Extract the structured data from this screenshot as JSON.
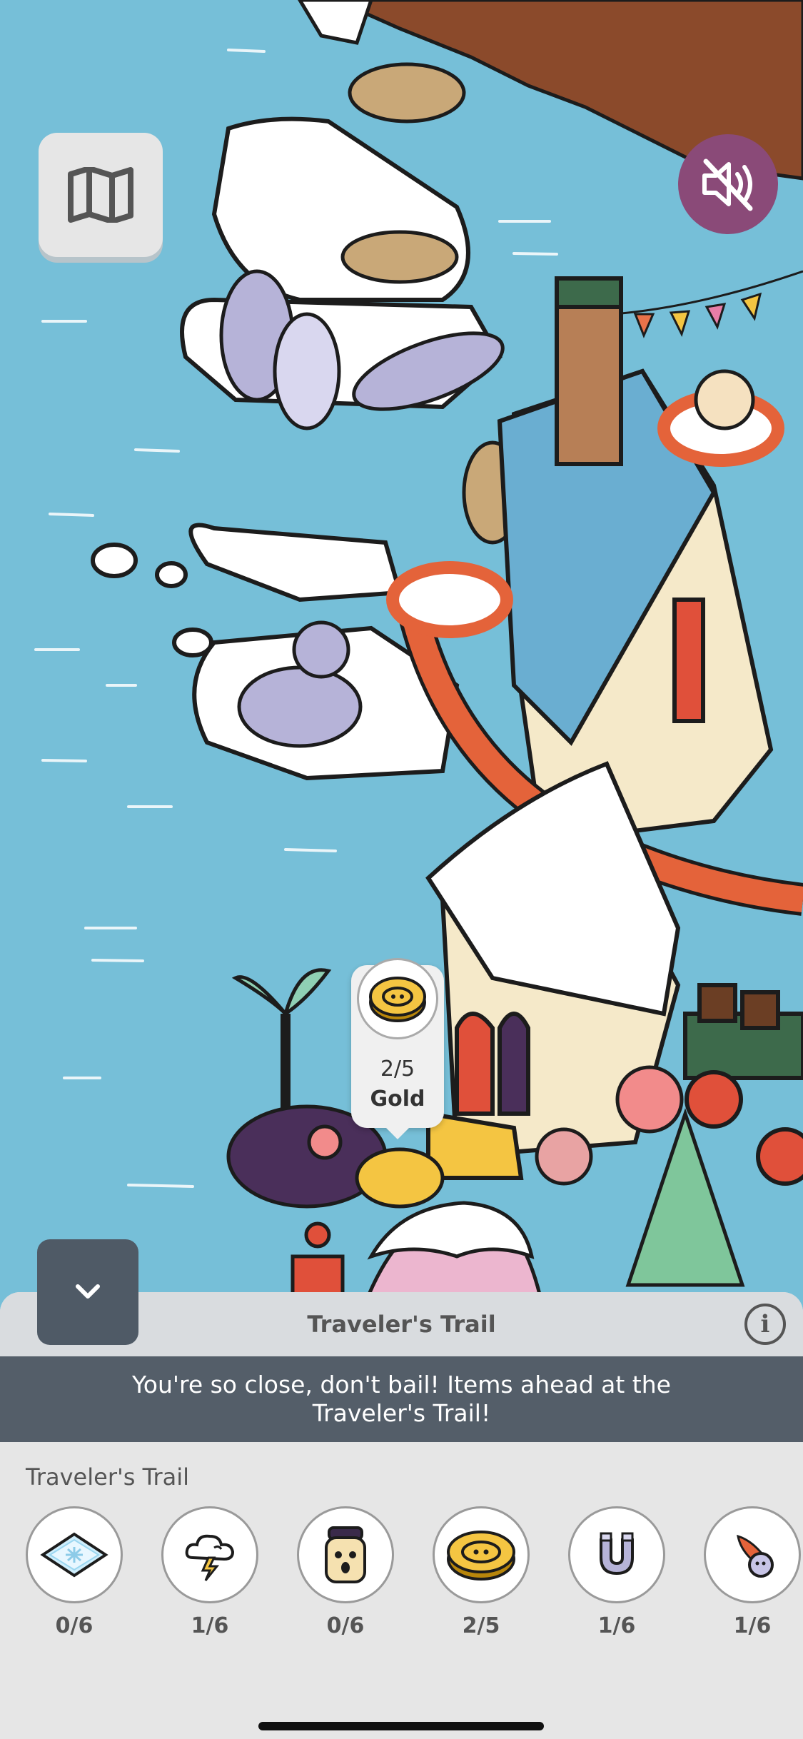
{
  "scene": {
    "gold_callout": {
      "count": "2/5",
      "label": "Gold",
      "icon": "gold-coin-icon"
    }
  },
  "controls": {
    "map_icon": "map-icon",
    "mute_icon": "sound-muted-icon",
    "collapse_icon": "chevron-down-icon"
  },
  "panel": {
    "title": "Traveler's Trail",
    "info_icon": "info-icon",
    "banner": "You're so close, don't bail! Items ahead at the Traveler's Trail!",
    "section_title": "Traveler's Trail",
    "items": [
      {
        "name": "ice-tile",
        "icon": "ice-tile-icon",
        "count": "0/6"
      },
      {
        "name": "storm-cloud",
        "icon": "storm-cloud-icon",
        "count": "1/6"
      },
      {
        "name": "jar-face",
        "icon": "jar-face-icon",
        "count": "0/6"
      },
      {
        "name": "gold",
        "icon": "gold-coin-icon",
        "count": "2/5"
      },
      {
        "name": "magnet",
        "icon": "magnet-icon",
        "count": "1/6"
      },
      {
        "name": "meteor",
        "icon": "meteor-icon",
        "count": "1/6"
      }
    ]
  },
  "colors": {
    "water": "#76bfd8",
    "panel_bg": "#e6e6e6",
    "banner_bg": "#545e69",
    "mute_button": "#8a4a78",
    "collapse_button": "#4f5a66"
  }
}
